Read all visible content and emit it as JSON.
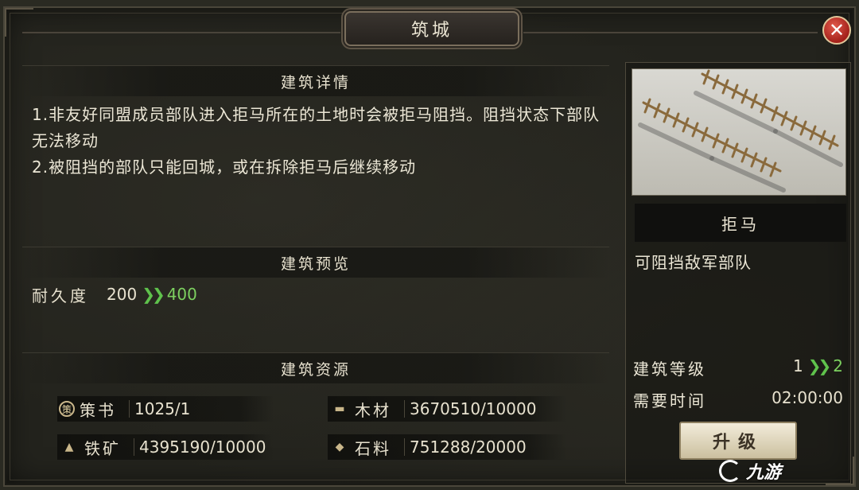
{
  "window": {
    "title": "筑城",
    "close_icon": "close-icon",
    "close_glyph": "✕"
  },
  "details": {
    "heading": "建筑详情",
    "lines": [
      "1.非友好同盟成员部队进入拒马所在的土地时会被拒马阻挡。阻挡状态下部队无法移动",
      "2.被阻挡的部队只能回城，或在拆除拒马后继续移动"
    ]
  },
  "preview_section": {
    "heading": "建筑预览",
    "durability_label": "耐久度",
    "durability_current": "200",
    "durability_next": "400",
    "arrow_icon": "double-chevron-right-icon",
    "arrow_glyph": "❯❯"
  },
  "resources": {
    "heading": "建筑资源",
    "items": [
      {
        "icon": "strategy-book-icon",
        "glyph": "策",
        "name": "策书",
        "value": "1025/1"
      },
      {
        "icon": "wood-icon",
        "glyph": "▬",
        "name": "木材",
        "value": "3670510/10000"
      },
      {
        "icon": "iron-ore-icon",
        "glyph": "▲",
        "name": "铁矿",
        "value": "4395190/10000"
      },
      {
        "icon": "stone-icon",
        "glyph": "◆",
        "name": "石料",
        "value": "751288/20000"
      }
    ]
  },
  "building": {
    "name": "拒马",
    "description": "可阻挡敌军部队",
    "level_label": "建筑等级",
    "level_current": "1",
    "level_next": "2",
    "time_label": "需要时间",
    "time_value": "02:00:00",
    "upgrade_label": "升级"
  },
  "watermark": {
    "text": "九游",
    "logo_icon": "nine-game-logo-icon"
  },
  "colors": {
    "accent_green": "#5fc24c",
    "close_red": "#c0322a"
  }
}
